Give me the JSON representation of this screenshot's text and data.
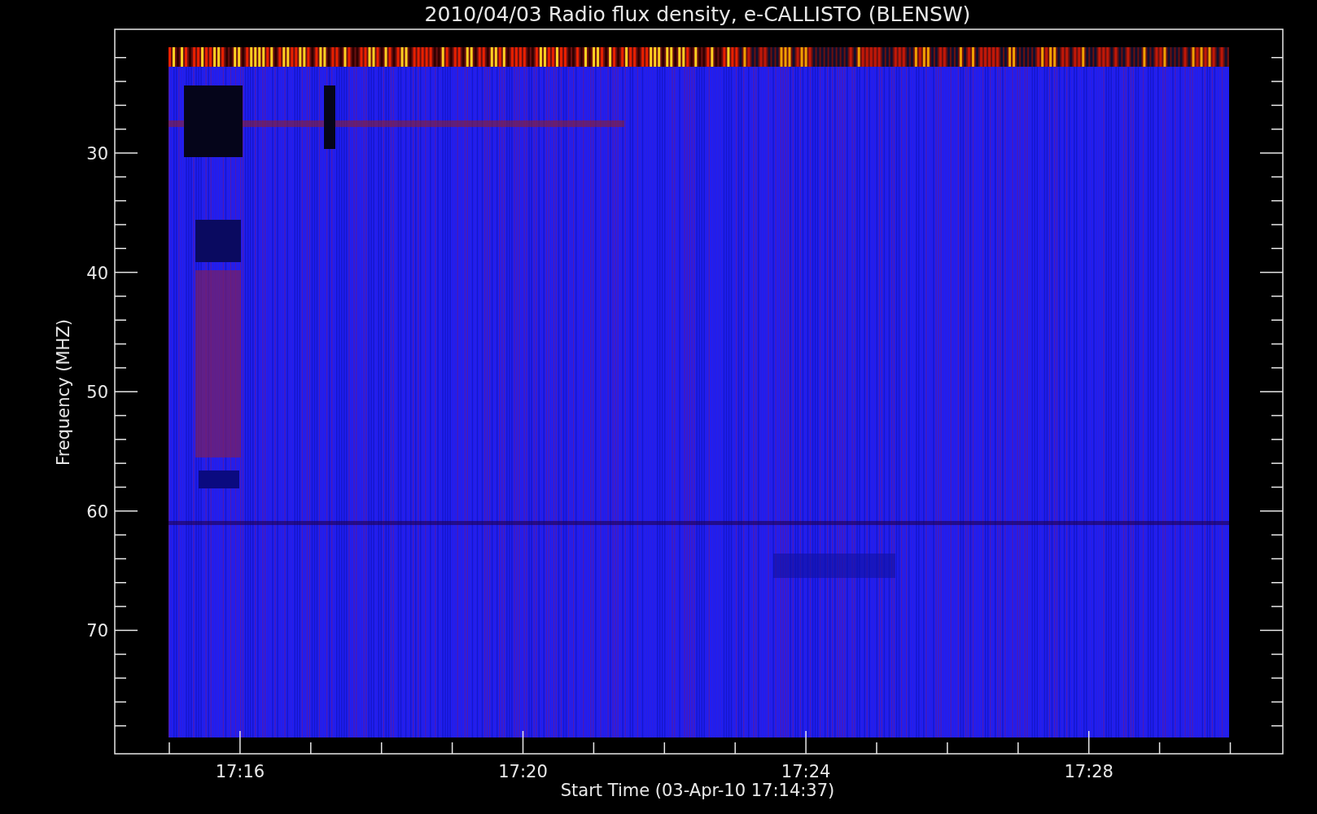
{
  "title": "2010/04/03  Radio flux density, e-CALLISTO (BLENSW)",
  "y_axis": {
    "label": "Frequency (MHZ)",
    "ticks": [
      "30",
      "40",
      "50",
      "60",
      "70"
    ]
  },
  "x_axis": {
    "label": "Start Time (03-Apr-10 17:14:37)",
    "ticks": [
      "17:16",
      "17:20",
      "17:24",
      "17:28"
    ]
  }
}
